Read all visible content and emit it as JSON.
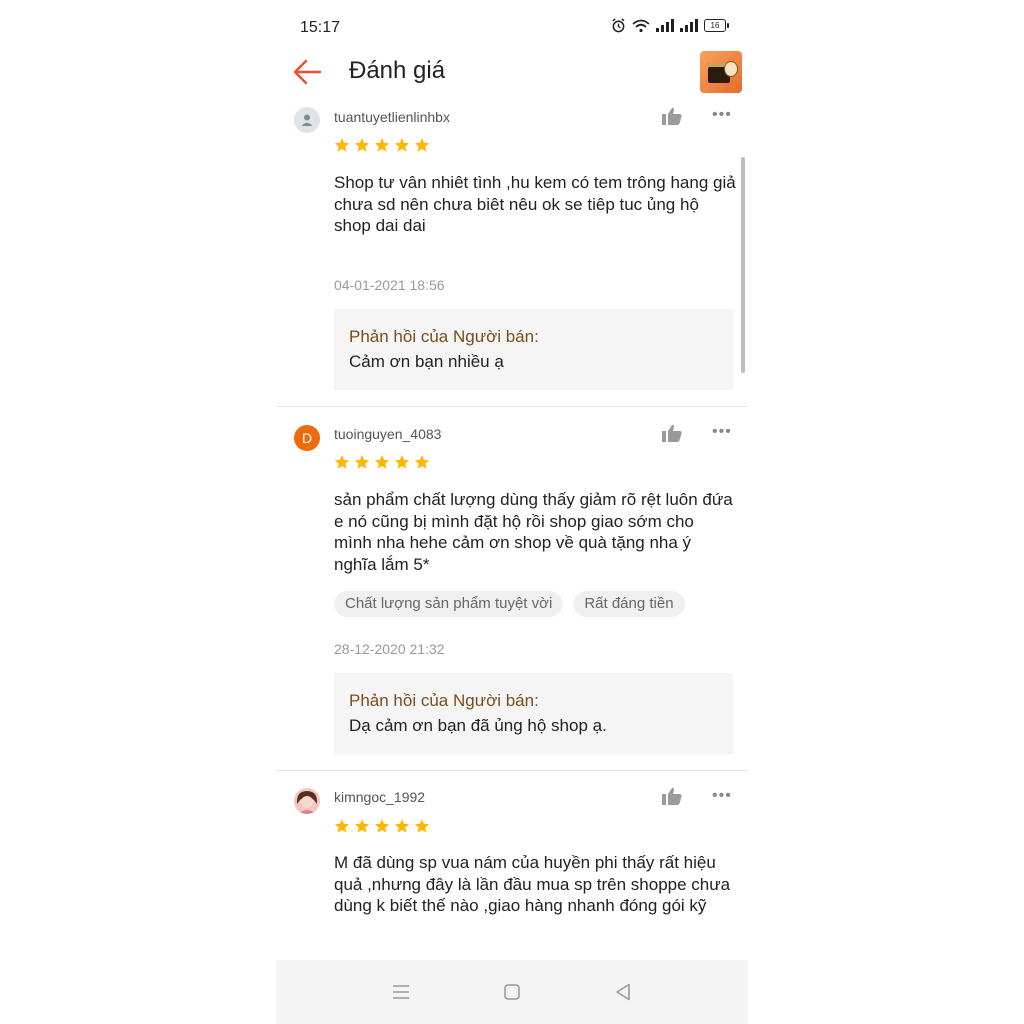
{
  "status_bar": {
    "time": "15:17",
    "battery": "16",
    "icons": [
      "alarm-icon",
      "wifi-icon",
      "signal-icon",
      "signal-icon",
      "battery-icon"
    ]
  },
  "header": {
    "title": "Đánh giá",
    "back_icon": "arrow-left-icon",
    "accent_color": "#ee4d2d"
  },
  "colors": {
    "star": "#ffb800",
    "reply_title": "#7a4d1c",
    "avatar_orange": "#ee6b0d"
  },
  "reviews": [
    {
      "username": "tuantuyetlienlinhbx",
      "avatar": "person-icon",
      "rating": 5,
      "text": "Shop tư vân nhiêt tình ,hu kem có tem trông hang giả chưa sd nên chưa biêt nêu ok se tiêp tuc ủng hộ shop dai dai",
      "tags": [],
      "date": "04-01-2021 18:56",
      "reply": {
        "title": "Phản hồi của Người bán:",
        "text": "Cảm ơn bạn nhiều ạ"
      }
    },
    {
      "username": "tuoinguyen_4083",
      "avatar_letter": "D",
      "rating": 5,
      "text": "sản phẩm chất lượng dùng thấy giảm rõ rệt luôn đứa e nó cũng bị mình đặt hộ rồi shop giao sớm cho mình nha hehe cảm ơn shop về quà tặng nha ý nghĩa lắm 5*",
      "tags": [
        "Chất lượng sản phẩm tuyệt vời",
        "Rất đáng tiền"
      ],
      "date": "28-12-2020 21:32",
      "reply": {
        "title": "Phản hồi của Người bán:",
        "text": "Dạ cảm ơn bạn đã ủng hộ shop ạ."
      }
    },
    {
      "username": "kimngoc_1992",
      "avatar": "profile-photo",
      "rating": 5,
      "text": "M đã dùng sp vua nám của huyền phi thấy rất hiệu quả ,nhưng đây là lần đầu mua sp trên shoppe chưa dùng k biết thế nào ,giao hàng nhanh đóng gói kỹ"
    }
  ],
  "navbar": {
    "icons": [
      "menu-icon",
      "home-square-icon",
      "back-triangle-icon"
    ]
  }
}
